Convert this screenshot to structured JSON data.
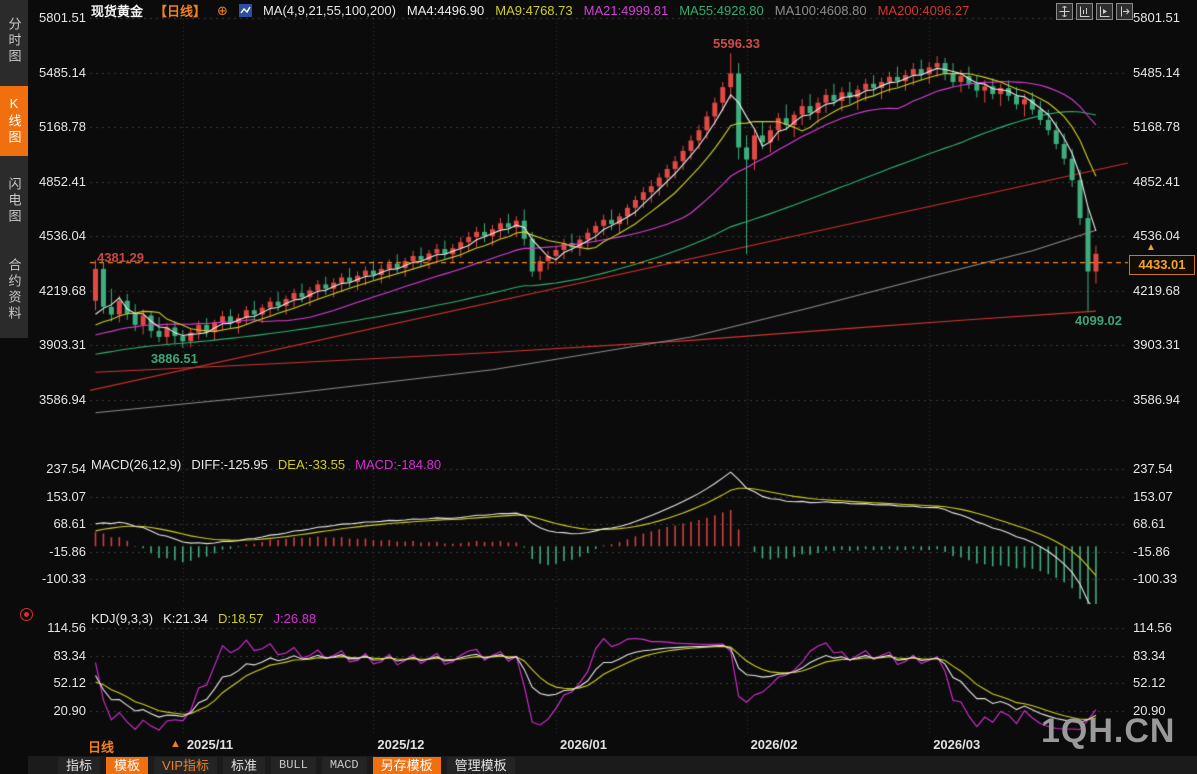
{
  "app": {
    "watermark": "1QH.CN"
  },
  "colors": {
    "up": "#e04a45",
    "down": "#3fae7e",
    "alert_line": "#f08a20",
    "trend": "#c92f2f",
    "ma4": "#ececec",
    "ma9": "#cfcf1f",
    "ma21": "#d63fd6",
    "ma55": "#2fae6e",
    "ma100": "#8d8d8d",
    "ma200": "#d23535",
    "diff": "#e8e8e8",
    "dea": "#cfcf1f",
    "macd_hist_pos": "#d04040",
    "macd_hist_neg": "#3fae7e",
    "k": "#e8e8e8",
    "d": "#cfcf1f",
    "j": "#d62fd6",
    "grid": "#3a3a3a",
    "vgrid": "#343434"
  },
  "sidebar": {
    "items": [
      {
        "label": "分时图",
        "active": false
      },
      {
        "label": "K线图",
        "active": true
      },
      {
        "label": "闪电图",
        "active": false
      },
      {
        "label": "合约资料",
        "active": false
      }
    ]
  },
  "header": {
    "symbol": "现货黄金",
    "period_tag": "【日线】",
    "circle_plus": "⊕",
    "ma_group_label": "MA(4,9,21,55,100,200)",
    "ma_values": [
      {
        "label": "MA4:4496.90",
        "color": "#ececec"
      },
      {
        "label": "MA9:4768.73",
        "color": "#cfcf1f"
      },
      {
        "label": "MA21:4999.81",
        "color": "#d63fd6"
      },
      {
        "label": "MA55:4928.80",
        "color": "#2fae6e"
      },
      {
        "label": "MA100:4608.80",
        "color": "#8d8d8d"
      },
      {
        "label": "MA200:4096.27",
        "color": "#d23535"
      }
    ]
  },
  "macd_panel": {
    "title": "MACD(26,12,9)",
    "values": [
      {
        "label": "DIFF:-125.95",
        "color": "#e8e8e8"
      },
      {
        "label": "DEA:-33.55",
        "color": "#cfcf1f"
      },
      {
        "label": "MACD:-184.80",
        "color": "#d62fd6"
      }
    ],
    "ticks": [
      237.54,
      153.07,
      68.61,
      -15.86,
      -100.33
    ]
  },
  "kdj_panel": {
    "title": "KDJ(9,3,3)",
    "values": [
      {
        "label": "K:21.34",
        "color": "#e8e8e8"
      },
      {
        "label": "D:18.57",
        "color": "#cfcf1f"
      },
      {
        "label": "J:26.88",
        "color": "#d62fd6"
      }
    ],
    "ticks": [
      114.56,
      83.34,
      52.12,
      20.9
    ]
  },
  "bottom": {
    "period_label": "日线",
    "arrow": "▲",
    "tabs": [
      {
        "label": "指标",
        "style": "plain"
      },
      {
        "label": "模板",
        "style": "orange"
      },
      {
        "label": "VIP指标",
        "style": "orange-text"
      },
      {
        "label": "标准",
        "style": "plain"
      },
      {
        "label": "BULL",
        "style": "mono"
      },
      {
        "label": "MACD",
        "style": "mono"
      },
      {
        "label": "另存模板",
        "style": "orange"
      },
      {
        "label": "管理模板",
        "style": "plain"
      }
    ]
  },
  "chart_data": {
    "type": "candlestick",
    "title": "现货黄金 日线",
    "y_axis_ticks": [
      5801.51,
      5485.14,
      5168.78,
      4852.41,
      4536.04,
      4219.68,
      3903.31,
      3586.94
    ],
    "month_ticks": [
      {
        "label": "2025/11",
        "index": 11
      },
      {
        "label": "2025/12",
        "index": 35
      },
      {
        "label": "2026/01",
        "index": 58
      },
      {
        "label": "2026/02",
        "index": 82
      },
      {
        "label": "2026/03",
        "index": 105
      }
    ],
    "annotations": {
      "high": {
        "text": "5596.33",
        "price": 5596.33,
        "color": "#d04a4a"
      },
      "alert": {
        "text": "4381.29",
        "price": 4381.29,
        "color": "#cc4444"
      },
      "low_nov": {
        "text": "3886.51",
        "price": 3886.51,
        "index": 11,
        "color": "#3fa477"
      },
      "low_recent": {
        "text": "4099.02",
        "price": 4099.02,
        "index": 125,
        "color": "#3fa477"
      }
    },
    "alert_line": {
      "price": 4381.29
    },
    "last_price": {
      "text": "4433.01",
      "price": 4433.01
    },
    "trend_line": {
      "start_price": 3640,
      "end_price": 4960
    },
    "ma_periods_computed": [
      4,
      9,
      21,
      55
    ],
    "ma_seed": {
      "start": 2800,
      "end": 4000,
      "count": 200
    },
    "ma100_path": [
      [
        0,
        3510
      ],
      [
        25,
        3625
      ],
      [
        50,
        3760
      ],
      [
        75,
        3950
      ],
      [
        90,
        4120
      ],
      [
        105,
        4300
      ],
      [
        118,
        4450
      ],
      [
        126,
        4570
      ]
    ],
    "ma200_path": [
      [
        0,
        3745
      ],
      [
        25,
        3800
      ],
      [
        50,
        3860
      ],
      [
        75,
        3930
      ],
      [
        95,
        4000
      ],
      [
        110,
        4050
      ],
      [
        126,
        4100
      ]
    ],
    "macd_params": {
      "slow": 26,
      "fast": 12,
      "signal": 9
    },
    "kdj_params": [
      9,
      3,
      3
    ],
    "candles": [
      [
        4160,
        4395,
        4105,
        4345
      ],
      [
        4345,
        4380,
        4085,
        4125
      ],
      [
        4125,
        4230,
        4040,
        4080
      ],
      [
        4080,
        4190,
        4035,
        4160
      ],
      [
        4160,
        4200,
        4050,
        4085
      ],
      [
        4085,
        4140,
        3985,
        4020
      ],
      [
        4020,
        4110,
        3965,
        4075
      ],
      [
        4075,
        4100,
        3945,
        3985
      ],
      [
        3985,
        4065,
        3920,
        3950
      ],
      [
        3950,
        4030,
        3905,
        4005
      ],
      [
        4005,
        4040,
        3915,
        3955
      ],
      [
        3955,
        3990,
        3886.51,
        3925
      ],
      [
        3925,
        4000,
        3890,
        3975
      ],
      [
        3975,
        4045,
        3935,
        4020
      ],
      [
        4020,
        4060,
        3950,
        3980
      ],
      [
        3980,
        4050,
        3930,
        4035
      ],
      [
        4035,
        4100,
        3990,
        4070
      ],
      [
        4070,
        4110,
        3995,
        4030
      ],
      [
        4030,
        4085,
        3970,
        4060
      ],
      [
        4060,
        4130,
        4020,
        4105
      ],
      [
        4105,
        4160,
        4050,
        4080
      ],
      [
        4080,
        4140,
        4030,
        4120
      ],
      [
        4120,
        4180,
        4070,
        4155
      ],
      [
        4155,
        4210,
        4100,
        4130
      ],
      [
        4130,
        4190,
        4080,
        4170
      ],
      [
        4170,
        4230,
        4120,
        4205
      ],
      [
        4205,
        4260,
        4150,
        4180
      ],
      [
        4180,
        4240,
        4130,
        4220
      ],
      [
        4220,
        4280,
        4170,
        4255
      ],
      [
        4255,
        4300,
        4195,
        4230
      ],
      [
        4230,
        4290,
        4180,
        4265
      ],
      [
        4265,
        4320,
        4210,
        4295
      ],
      [
        4295,
        4350,
        4240,
        4270
      ],
      [
        4270,
        4330,
        4220,
        4305
      ],
      [
        4305,
        4360,
        4250,
        4335
      ],
      [
        4335,
        4390,
        4280,
        4310
      ],
      [
        4310,
        4370,
        4260,
        4345
      ],
      [
        4345,
        4400,
        4290,
        4375
      ],
      [
        4375,
        4430,
        4320,
        4350
      ],
      [
        4350,
        4410,
        4300,
        4390
      ],
      [
        4390,
        4450,
        4340,
        4420
      ],
      [
        4420,
        4470,
        4360,
        4395
      ],
      [
        4395,
        4455,
        4345,
        4435
      ],
      [
        4435,
        4490,
        4380,
        4460
      ],
      [
        4460,
        4510,
        4400,
        4430
      ],
      [
        4430,
        4490,
        4380,
        4465
      ],
      [
        4465,
        4530,
        4410,
        4500
      ],
      [
        4500,
        4560,
        4450,
        4530
      ],
      [
        4530,
        4590,
        4470,
        4560
      ],
      [
        4560,
        4610,
        4500,
        4535
      ],
      [
        4535,
        4600,
        4480,
        4575
      ],
      [
        4575,
        4640,
        4520,
        4610
      ],
      [
        4610,
        4665,
        4550,
        4585
      ],
      [
        4585,
        4650,
        4530,
        4625
      ],
      [
        4625,
        4690,
        4480,
        4520
      ],
      [
        4520,
        4560,
        4300,
        4330
      ],
      [
        4330,
        4420,
        4280,
        4390
      ],
      [
        4390,
        4450,
        4340,
        4420
      ],
      [
        4420,
        4480,
        4370,
        4455
      ],
      [
        4455,
        4520,
        4400,
        4495
      ],
      [
        4495,
        4550,
        4440,
        4470
      ],
      [
        4470,
        4540,
        4420,
        4515
      ],
      [
        4515,
        4580,
        4460,
        4555
      ],
      [
        4555,
        4620,
        4500,
        4595
      ],
      [
        4595,
        4660,
        4540,
        4630
      ],
      [
        4630,
        4690,
        4570,
        4605
      ],
      [
        4605,
        4670,
        4550,
        4650
      ],
      [
        4650,
        4720,
        4600,
        4700
      ],
      [
        4700,
        4770,
        4650,
        4745
      ],
      [
        4745,
        4820,
        4700,
        4790
      ],
      [
        4790,
        4860,
        4730,
        4825
      ],
      [
        4825,
        4900,
        4770,
        4875
      ],
      [
        4875,
        4950,
        4820,
        4925
      ],
      [
        4925,
        5000,
        4870,
        4970
      ],
      [
        4970,
        5060,
        4920,
        5030
      ],
      [
        5030,
        5120,
        4980,
        5090
      ],
      [
        5090,
        5180,
        5040,
        5150
      ],
      [
        5150,
        5260,
        5100,
        5230
      ],
      [
        5230,
        5340,
        5180,
        5310
      ],
      [
        5310,
        5430,
        5260,
        5400
      ],
      [
        5400,
        5596.33,
        5330,
        5480
      ],
      [
        5480,
        5540,
        4980,
        5050
      ],
      [
        5050,
        5120,
        4430,
        4980
      ],
      [
        4980,
        5160,
        4920,
        5120
      ],
      [
        5120,
        5200,
        5040,
        5080
      ],
      [
        5080,
        5180,
        5020,
        5150
      ],
      [
        5150,
        5250,
        5090,
        5220
      ],
      [
        5220,
        5300,
        5150,
        5180
      ],
      [
        5180,
        5260,
        5110,
        5240
      ],
      [
        5240,
        5330,
        5180,
        5290
      ],
      [
        5290,
        5360,
        5210,
        5250
      ],
      [
        5250,
        5340,
        5190,
        5310
      ],
      [
        5310,
        5390,
        5250,
        5355
      ],
      [
        5355,
        5420,
        5290,
        5320
      ],
      [
        5320,
        5400,
        5260,
        5370
      ],
      [
        5370,
        5430,
        5300,
        5340
      ],
      [
        5340,
        5410,
        5270,
        5385
      ],
      [
        5385,
        5450,
        5320,
        5420
      ],
      [
        5420,
        5470,
        5350,
        5395
      ],
      [
        5395,
        5455,
        5330,
        5430
      ],
      [
        5430,
        5490,
        5370,
        5460
      ],
      [
        5460,
        5520,
        5400,
        5435
      ],
      [
        5435,
        5500,
        5380,
        5470
      ],
      [
        5470,
        5540,
        5410,
        5505
      ],
      [
        5505,
        5560,
        5440,
        5475
      ],
      [
        5475,
        5545,
        5420,
        5515
      ],
      [
        5515,
        5580,
        5460,
        5540
      ],
      [
        5540,
        5570,
        5440,
        5480
      ],
      [
        5480,
        5540,
        5400,
        5430
      ],
      [
        5430,
        5500,
        5370,
        5465
      ],
      [
        5465,
        5520,
        5390,
        5420
      ],
      [
        5420,
        5470,
        5340,
        5380
      ],
      [
        5380,
        5440,
        5310,
        5405
      ],
      [
        5405,
        5450,
        5330,
        5360
      ],
      [
        5360,
        5420,
        5290,
        5395
      ],
      [
        5395,
        5440,
        5320,
        5350
      ],
      [
        5350,
        5400,
        5270,
        5300
      ],
      [
        5300,
        5360,
        5230,
        5330
      ],
      [
        5330,
        5370,
        5240,
        5270
      ],
      [
        5270,
        5320,
        5180,
        5210
      ],
      [
        5210,
        5270,
        5120,
        5150
      ],
      [
        5150,
        5200,
        5040,
        5070
      ],
      [
        5070,
        5130,
        4950,
        4985
      ],
      [
        4985,
        5040,
        4820,
        4860
      ],
      [
        4860,
        4920,
        4600,
        4640
      ],
      [
        4640,
        4700,
        4099.02,
        4330
      ],
      [
        4330,
        4480,
        4260,
        4433.01
      ]
    ]
  }
}
